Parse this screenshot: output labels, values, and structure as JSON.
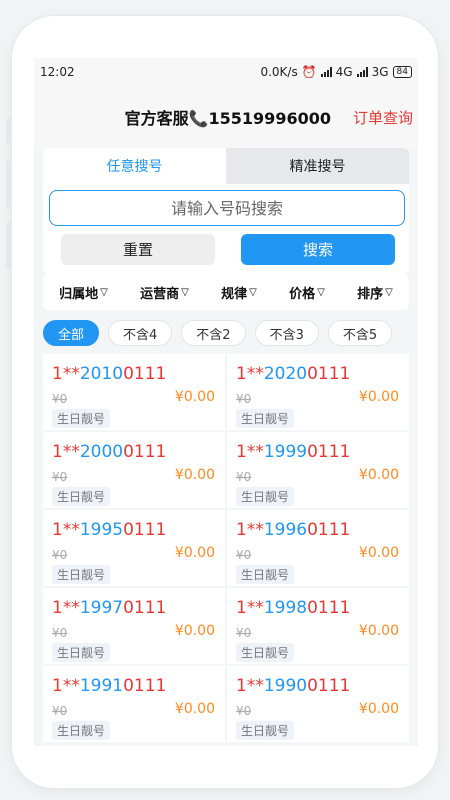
{
  "statusbar": {
    "time": "12:02",
    "net_speed": "0.0K/s",
    "net1": "4G",
    "net2": "3G",
    "battery": "84"
  },
  "header": {
    "service": "官方客服📞15519996000",
    "order": "订单查询"
  },
  "search": {
    "tabs": [
      {
        "label": "任意搜号"
      },
      {
        "label": "精准搜号"
      }
    ],
    "placeholder": "请输入号码搜索",
    "reset_label": "重置",
    "search_label": "搜索"
  },
  "filters": [
    {
      "label": "归属地"
    },
    {
      "label": "运营商"
    },
    {
      "label": "规律"
    },
    {
      "label": "价格"
    },
    {
      "label": "排序"
    }
  ],
  "chips": [
    {
      "label": "全部"
    },
    {
      "label": "不含4"
    },
    {
      "label": "不含2"
    },
    {
      "label": "不含3"
    },
    {
      "label": "不含5"
    }
  ],
  "numbers": [
    {
      "prefix": "1**",
      "mid": "2010",
      "tail": "0111",
      "orig": "¥0",
      "price": "¥0.00",
      "tag": "生日靓号"
    },
    {
      "prefix": "1**",
      "mid": "2020",
      "tail": "0111",
      "orig": "¥0",
      "price": "¥0.00",
      "tag": "生日靓号"
    },
    {
      "prefix": "1**",
      "mid": "2000",
      "tail": "0111",
      "orig": "¥0",
      "price": "¥0.00",
      "tag": "生日靓号"
    },
    {
      "prefix": "1**",
      "mid": "1999",
      "tail": "0111",
      "orig": "¥0",
      "price": "¥0.00",
      "tag": "生日靓号"
    },
    {
      "prefix": "1**",
      "mid": "1995",
      "tail": "0111",
      "orig": "¥0",
      "price": "¥0.00",
      "tag": "生日靓号"
    },
    {
      "prefix": "1**",
      "mid": "1996",
      "tail": "0111",
      "orig": "¥0",
      "price": "¥0.00",
      "tag": "生日靓号"
    },
    {
      "prefix": "1**",
      "mid": "1997",
      "tail": "0111",
      "orig": "¥0",
      "price": "¥0.00",
      "tag": "生日靓号"
    },
    {
      "prefix": "1**",
      "mid": "1998",
      "tail": "0111",
      "orig": "¥0",
      "price": "¥0.00",
      "tag": "生日靓号"
    },
    {
      "prefix": "1**",
      "mid": "1991",
      "tail": "0111",
      "orig": "¥0",
      "price": "¥0.00",
      "tag": "生日靓号"
    },
    {
      "prefix": "1**",
      "mid": "1990",
      "tail": "0111",
      "orig": "¥0",
      "price": "¥0.00",
      "tag": "生日靓号"
    }
  ]
}
